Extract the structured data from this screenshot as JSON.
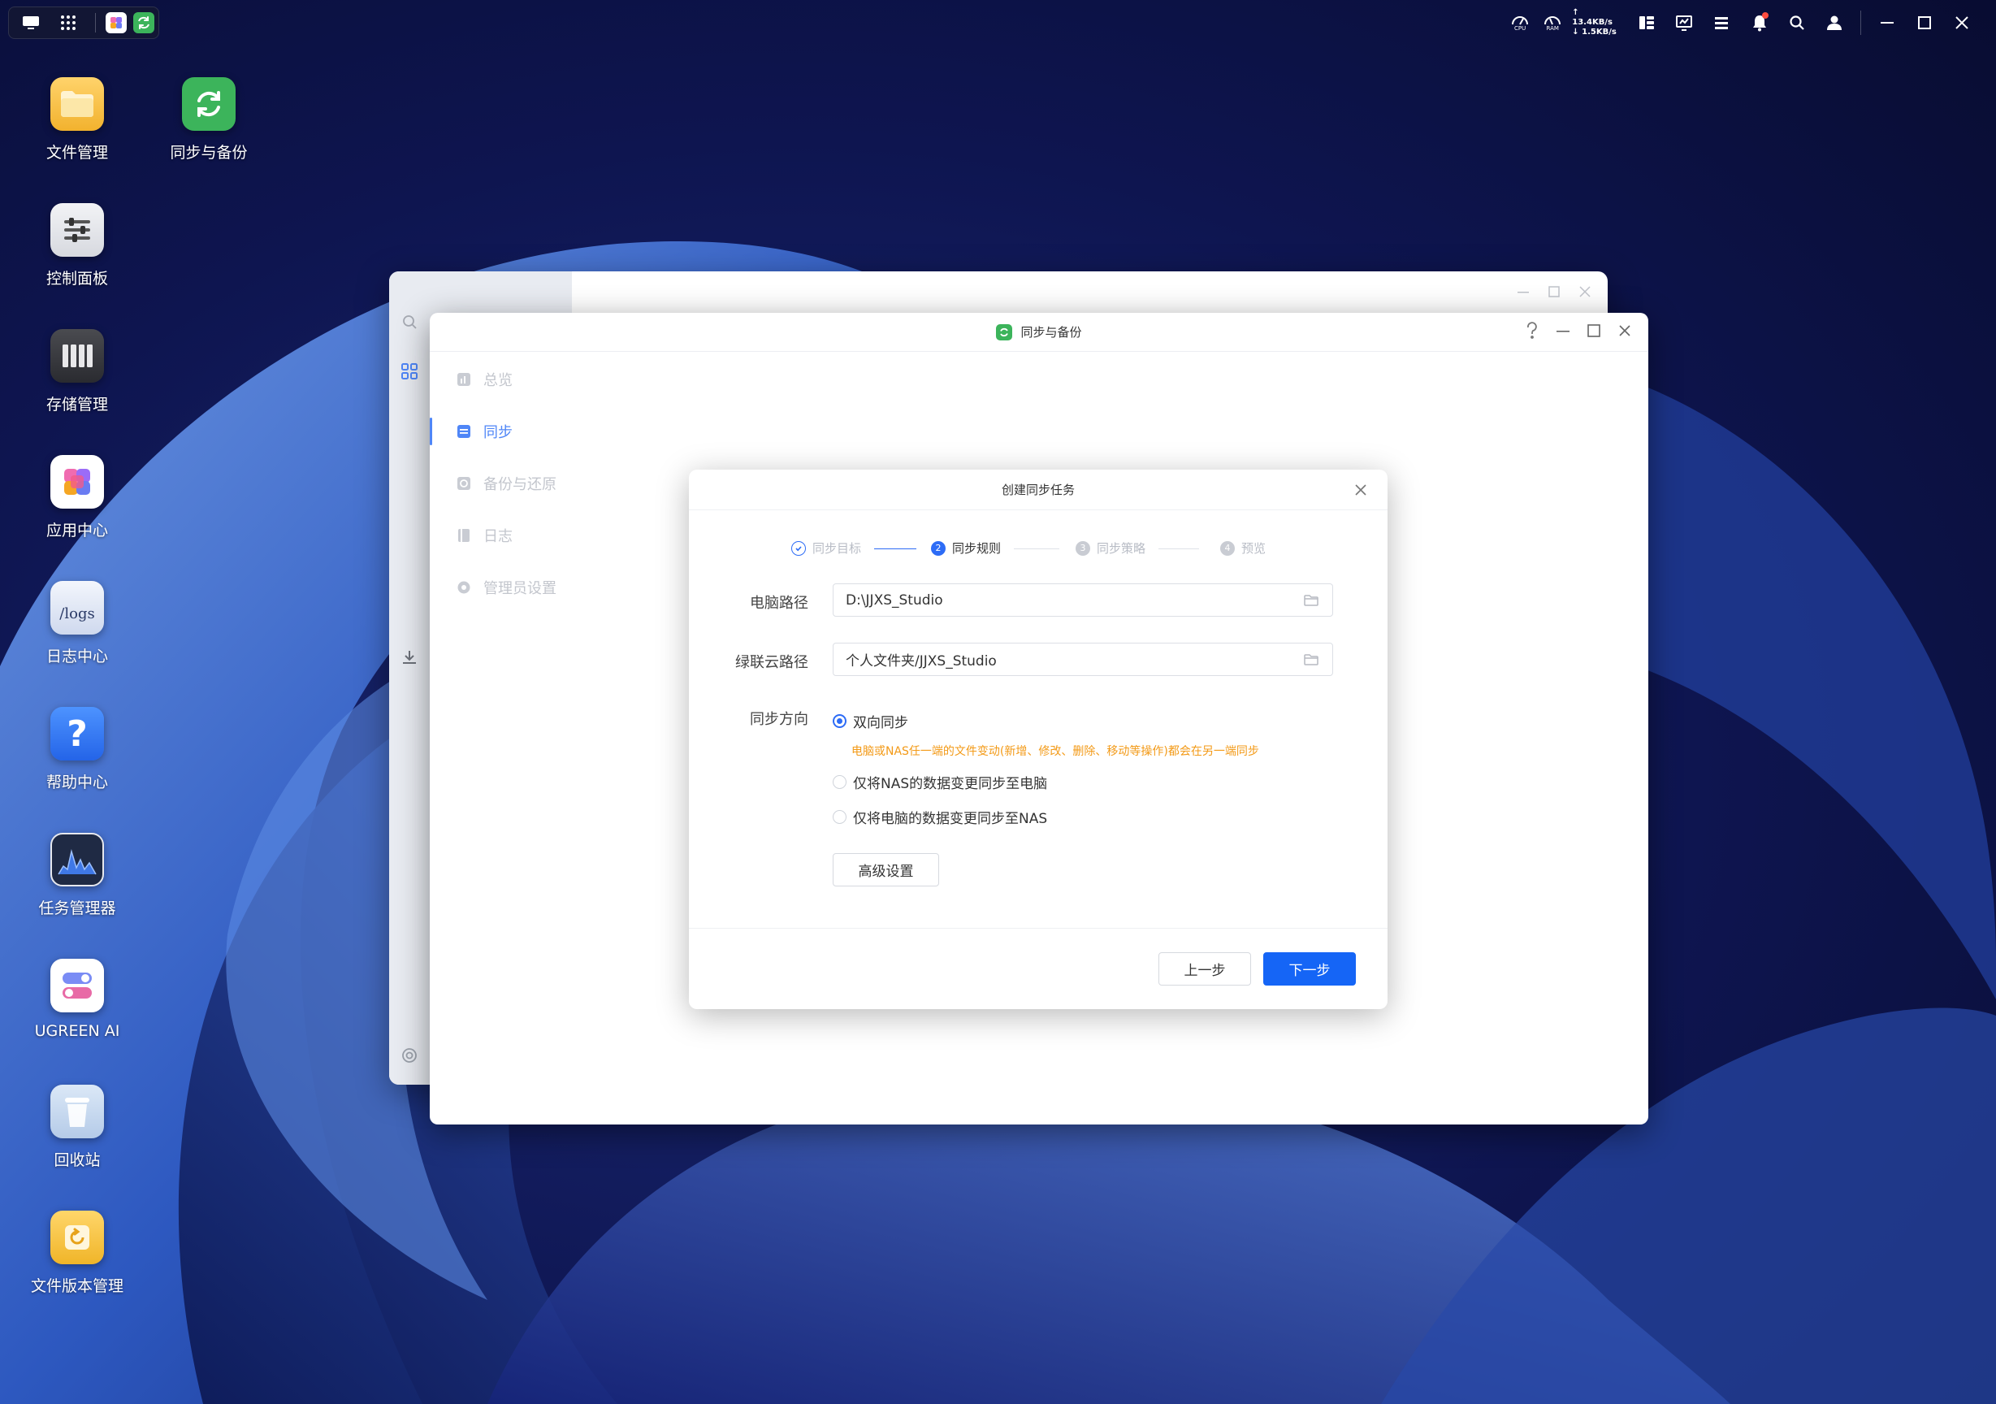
{
  "taskbar": {
    "net_up": "13.4KB/s",
    "net_down": "1.5KB/s",
    "cpu_label": "CPU",
    "ram_label": "RAM"
  },
  "desktop": {
    "icons": [
      {
        "label": "文件管理",
        "icon": "folder-icon",
        "color": "#f5c347"
      },
      {
        "label": "同步与备份",
        "icon": "sync-icon",
        "color": "#3cb45b"
      },
      {
        "label": "控制面板",
        "icon": "sliders-icon",
        "color": "#e9eaee"
      },
      {
        "label": "存储管理",
        "icon": "drives-icon",
        "color": "#3a3b3f"
      },
      {
        "label": "应用中心",
        "icon": "app-center-icon",
        "color": "#ffffff"
      },
      {
        "label": "日志中心",
        "icon": "logs-icon",
        "color": "#dfe6f5",
        "tile_text": "/logs"
      },
      {
        "label": "帮助中心",
        "icon": "help-icon",
        "color": "#2f7cf6",
        "tile_text": "?"
      },
      {
        "label": "任务管理器",
        "icon": "task-chart-icon",
        "color": "#1f2a44"
      },
      {
        "label": "UGREEN AI",
        "icon": "toggles-icon",
        "color": "#ffffff"
      },
      {
        "label": "回收站",
        "icon": "trash-icon",
        "color": "#cfe0f4"
      },
      {
        "label": "文件版本管理",
        "icon": "version-icon",
        "color": "#f4c443"
      }
    ]
  },
  "app": {
    "title": "同步与备份",
    "nav": [
      {
        "label": "总览",
        "icon": "overview-icon"
      },
      {
        "label": "同步",
        "icon": "sync-list-icon",
        "active": true
      },
      {
        "label": "备份与还原",
        "icon": "backup-icon"
      },
      {
        "label": "日志",
        "icon": "log-book-icon"
      },
      {
        "label": "管理员设置",
        "icon": "gear-icon"
      }
    ]
  },
  "modal": {
    "title": "创建同步任务",
    "steps": [
      "同步目标",
      "同步规则",
      "同步策略",
      "预览"
    ],
    "step_numbers": [
      "2",
      "3",
      "4"
    ],
    "pc_path_label": "电脑路径",
    "pc_path_value": "D:\\JJXS_Studio",
    "cloud_path_label": "绿联云路径",
    "cloud_path_value": "个人文件夹/JJXS_Studio",
    "direction_label": "同步方向",
    "options": [
      "双向同步",
      "仅将NAS的数据变更同步至电脑",
      "仅将电脑的数据变更同步至NAS"
    ],
    "hint": "电脑或NAS任一端的文件变动(新增、修改、删除、移动等操作)都会在另一端同步",
    "advanced_button": "高级设置",
    "prev_button": "上一步",
    "next_button": "下一步"
  },
  "colors": {
    "accent": "#1565f6",
    "hint": "#f39a17"
  }
}
